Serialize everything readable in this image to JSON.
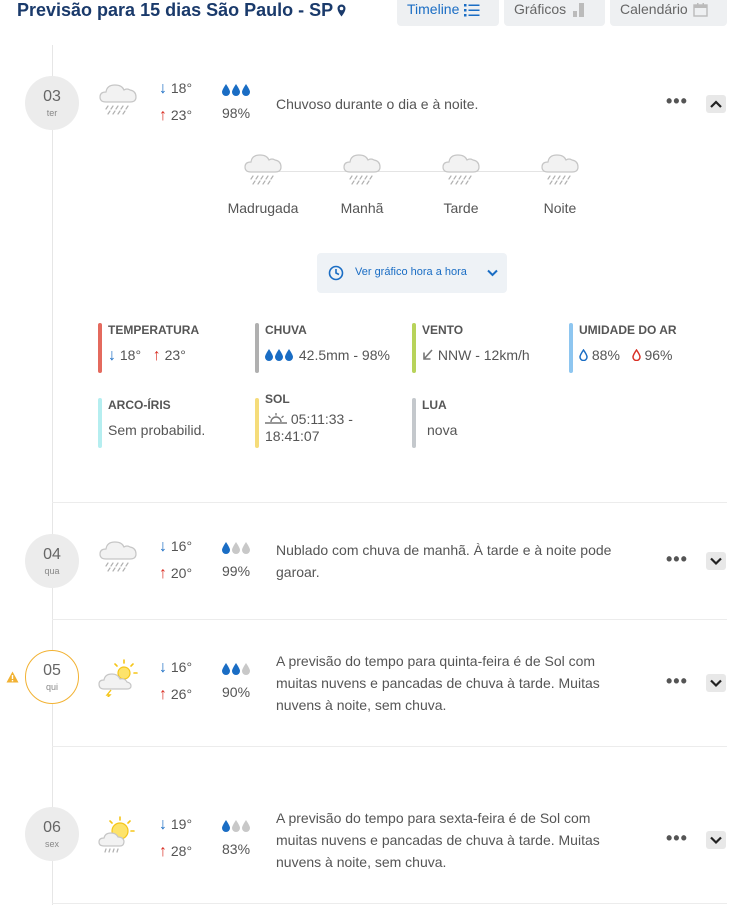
{
  "header": {
    "title": "Previsão para 15 dias São Paulo - SP",
    "views": [
      "Timeline",
      "Gráficos",
      "Calendário"
    ],
    "active_view": "Timeline"
  },
  "colors": {
    "title": "#1a3a6b",
    "accent": "#1a6dc4",
    "min_temp": "#1a6dc4",
    "max_temp": "#d93025",
    "warning": "#f2b233"
  },
  "days": [
    {
      "day": "03",
      "weekday": "ter",
      "icon": "rain-cloud-icon",
      "min": "18°",
      "max": "23°",
      "rain": "98%",
      "rain_drops_filled": 3,
      "description": "Chuvoso durante o dia e à noite.",
      "expanded": true,
      "periods": [
        {
          "label": "Madrugada",
          "icon": "rain-cloud-icon"
        },
        {
          "label": "Manhã",
          "icon": "rain-cloud-icon"
        },
        {
          "label": "Tarde",
          "icon": "rain-cloud-icon"
        },
        {
          "label": "Noite",
          "icon": "rain-cloud-icon"
        }
      ],
      "hourly_button": "Ver gráfico hora a hora",
      "details": {
        "temperature": {
          "title": "TEMPERATURA",
          "min": "18°",
          "max": "23°"
        },
        "rain": {
          "title": "CHUVA",
          "value": "42.5mm - 98%"
        },
        "wind": {
          "title": "VENTO",
          "value": "NNW - 12km/h"
        },
        "humidity": {
          "title": "UMIDADE DO AR",
          "min": "88%",
          "max": "96%"
        },
        "rainbow": {
          "title": "ARCO-ÍRIS",
          "value": "Sem probabilid."
        },
        "sun": {
          "title": "SOL",
          "value_line1": "05:11:33 -",
          "value_line2": "18:41:07"
        },
        "moon": {
          "title": "LUA",
          "value": "nova"
        }
      }
    },
    {
      "day": "04",
      "weekday": "qua",
      "icon": "rain-cloud-icon",
      "min": "16°",
      "max": "20°",
      "rain": "99%",
      "rain_drops_filled": 1,
      "description_line1": "Nublado com chuva de manhã. À tarde e à noite pode",
      "description_line2": "garoar."
    },
    {
      "day": "05",
      "weekday": "qui",
      "icon": "sun-cloud-storm-icon",
      "warning": true,
      "min": "16°",
      "max": "26°",
      "rain": "90%",
      "rain_drops_filled": 2,
      "description_line1": "A previsão do tempo para quinta-feira é de Sol com",
      "description_line2": "muitas nuvens e pancadas de chuva à tarde. Muitas",
      "description_line3": "nuvens à noite, sem chuva."
    },
    {
      "day": "06",
      "weekday": "sex",
      "icon": "sun-cloud-rain-icon",
      "min": "19°",
      "max": "28°",
      "rain": "83%",
      "rain_drops_filled": 1,
      "description_line1": "A previsão do tempo para sexta-feira é de Sol com",
      "description_line2": "muitas nuvens e pancadas de chuva à tarde. Muitas",
      "description_line3": "nuvens à noite, sem chuva."
    }
  ]
}
